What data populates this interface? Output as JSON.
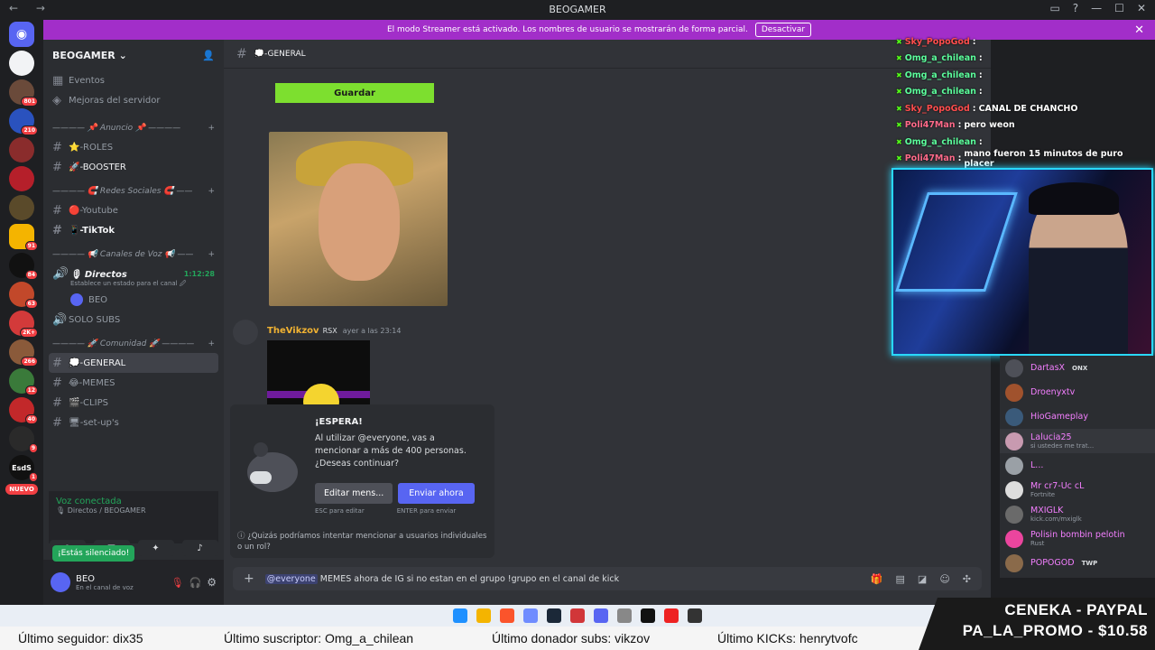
{
  "window": {
    "title": "BEOGAMER"
  },
  "streamer_banner": {
    "text": "El modo Streamer está activado. Los nombres de usuario se mostrarán de forma parcial.",
    "button": "Desactivar"
  },
  "rail": {
    "badges": [
      "801",
      "210",
      "",
      "",
      "",
      "91",
      "84",
      "63",
      "2K+",
      "266",
      "12",
      "40",
      "9",
      "1"
    ],
    "nuevo": "NUEVO",
    "esds": "EsdS"
  },
  "server": {
    "name": "BEOGAMER"
  },
  "sidebar": {
    "top": [
      "Eventos",
      "Mejoras del servidor"
    ],
    "cat1": "———— 📌 Anuncio 📌 ————",
    "roles": "⭐-ROLES",
    "booster": "🚀-BOOSTER",
    "cat2": "———— 🧲 Redes Sociales 🧲 ——",
    "youtube": "🔴-Youtube",
    "tiktok": "📱-TikTok",
    "cat3": "———— 📢 Canales de Voz 📢 ——",
    "directos": "🎙 Directos",
    "directos_time": "1:12:28",
    "directos_status": "Establece un estado para el canal 🖉",
    "beo": "BEO",
    "solosubs": "SOLO SUBS",
    "cat4": "———— 🚀 Comunidad 🚀 ————",
    "general": "💭-GENERAL",
    "memes": "😂-MEMES",
    "clips": "🎬-CLIPS",
    "setups": "🖥-set-up's"
  },
  "voice": {
    "status": "Voz conectada",
    "channel": "🎙 Directos / BEOGAMER"
  },
  "tooltip": "¡Estás silenciado!",
  "user": {
    "name": "BEO",
    "status": "En el canal de voz"
  },
  "chat_header": {
    "channel": "💭-GENERAL"
  },
  "message": {
    "save_button": "Guardar",
    "author": "TheVikzov",
    "tag": "RSX",
    "time": "ayer a las 23:14"
  },
  "modal": {
    "title": "¡ESPERA!",
    "body": "Al utilizar @everyone, vas a mencionar a más de 400 personas. ¿Deseas continuar?",
    "edit_button": "Editar mens...",
    "send_button": "Enviar ahora",
    "hint_edit": "ESC para editar",
    "hint_send": "ENTER para enviar",
    "footer": "¿Quizás podríamos intentar mencionar a usuarios individuales o un rol?"
  },
  "input": {
    "mention": "@everyone",
    "text": "MEMES ahora de IG si no estan en el grupo !grupo en el canal de kick"
  },
  "overlay_chat": [
    {
      "user": "Sky_PopoGod",
      "color": "#ff4d4d",
      "msg": ""
    },
    {
      "user": "Omg_a_chilean",
      "color": "#5cff9d",
      "msg": ""
    },
    {
      "user": "Omg_a_chilean",
      "color": "#5cff9d",
      "msg": ""
    },
    {
      "user": "Omg_a_chilean",
      "color": "#5cff9d",
      "msg": ""
    },
    {
      "user": "Sky_PopoGod",
      "color": "#ff4d4d",
      "msg": "CANAL DE CHANCHO"
    },
    {
      "user": "Poli47Man",
      "color": "#ff6a8a",
      "msg": "pero weon"
    },
    {
      "user": "Omg_a_chilean",
      "color": "#5cff9d",
      "msg": ""
    },
    {
      "user": "Poli47Man",
      "color": "#ff6a8a",
      "msg": "mano fueron 15 minutos de puro placer"
    }
  ],
  "members": [
    {
      "name": "DartasX",
      "extra": "ONX",
      "color": "#f47fff",
      "sub": ""
    },
    {
      "name": "Droenyxtv",
      "extra": "",
      "color": "#f47fff",
      "sub": ""
    },
    {
      "name": "HioGameplay",
      "extra": "",
      "color": "#f47fff",
      "sub": ""
    },
    {
      "name": "Lalucia25",
      "extra": "",
      "color": "#f47fff",
      "sub": "si ustedes me trat..."
    },
    {
      "name": "L...",
      "extra": "",
      "color": "#f47fff",
      "sub": ""
    },
    {
      "name": "Mr cr7-Uc cL",
      "extra": "",
      "color": "#f47fff",
      "sub": "Fortnite"
    },
    {
      "name": "MXIGLK",
      "extra": "",
      "color": "#f47fff",
      "sub": "kick.com/mxiglk"
    },
    {
      "name": "Polisin bombin pelotin",
      "extra": "",
      "color": "#f47fff",
      "sub": "Rust"
    },
    {
      "name": "POPOGOD",
      "extra": "TWP",
      "color": "#f47fff",
      "sub": ""
    }
  ],
  "ticker": {
    "follower": "Último seguidor: dix35",
    "subscriber": "Último suscriptor: Omg_a_chilean",
    "donor": "Último donador subs: vikzov",
    "kicks": "Último KICKs: henrytvofc"
  },
  "promo": {
    "line1": "CENEKA - PAYPAL",
    "line2": "PA_LA_PROMO - $10.58"
  }
}
